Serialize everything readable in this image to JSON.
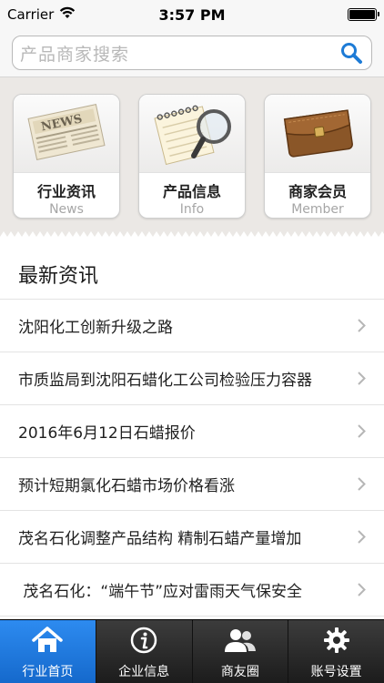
{
  "status_bar": {
    "carrier": "Carrier",
    "time": "3:57 PM",
    "battery_level": 1.0
  },
  "search": {
    "placeholder": "产品商家搜索"
  },
  "categories": [
    {
      "title": "行业资讯",
      "subtitle": "News",
      "icon": "newspaper-icon"
    },
    {
      "title": "产品信息",
      "subtitle": "Info",
      "icon": "notepad-magnifier-icon"
    },
    {
      "title": "商家会员",
      "subtitle": "Member",
      "icon": "wallet-icon"
    }
  ],
  "news": {
    "header": "最新资讯",
    "items": [
      "沈阳化工创新升级之路",
      "市质监局到沈阳石蜡化工公司检验压力容器",
      "2016年6月12日石蜡报价",
      "预计短期氯化石蜡市场价格看涨",
      "茂名石化调整产品结构 精制石蜡产量增加",
      " 茂名石化：“端午节”应对雷雨天气保安全"
    ]
  },
  "tabs": [
    {
      "label": "行业首页",
      "icon": "home-icon",
      "active": true
    },
    {
      "label": "企业信息",
      "icon": "info-icon",
      "active": false
    },
    {
      "label": "商友圈",
      "icon": "people-icon",
      "active": false
    },
    {
      "label": "账号设置",
      "icon": "gear-icon",
      "active": false
    }
  ],
  "colors": {
    "tab_active": "#1f7be0",
    "tab_bar": "#2a2a2a",
    "search_icon": "#1d7bd6"
  }
}
